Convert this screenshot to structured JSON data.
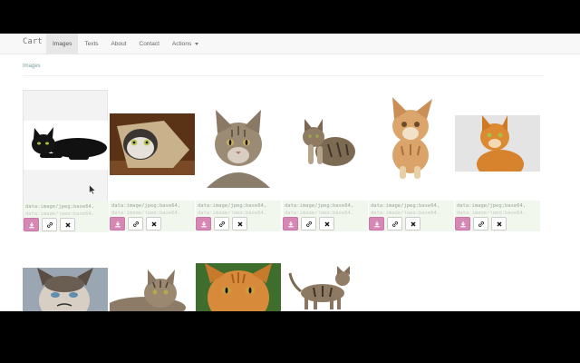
{
  "navbar": {
    "brand": "Cart",
    "items": [
      {
        "label": "Images"
      },
      {
        "label": "Texts"
      },
      {
        "label": "About"
      },
      {
        "label": "Contact"
      },
      {
        "label": "Actions"
      }
    ],
    "active_index": 0
  },
  "breadcrumb": "Images",
  "images": [
    {
      "uri": "data:image/jpeg;base64,",
      "subject": "black cat lying down"
    },
    {
      "uri": "data:image/jpeg;base64,",
      "subject": "cat in paper bag"
    },
    {
      "uri": "data:image/jpeg;base64,",
      "subject": "tabby cat portrait"
    },
    {
      "uri": "data:image/jpeg;base64,",
      "subject": "tabby cat sitting"
    },
    {
      "uri": "data:image/jpeg;base64,",
      "subject": "ginger kitten"
    },
    {
      "uri": "data:image/jpeg;base64,",
      "subject": "orange cat"
    },
    {
      "subject": "grumpy cat"
    },
    {
      "subject": "tabby cat lying"
    },
    {
      "subject": "orange cat close-up"
    },
    {
      "subject": "tabby cat standing"
    }
  ],
  "icons": {
    "download": "download-icon",
    "link": "link-icon",
    "remove": "close-icon"
  },
  "colors": {
    "download_button": "#d488b3",
    "card_footer": "#f1f7ed",
    "navbar": "#f8f8f8"
  }
}
